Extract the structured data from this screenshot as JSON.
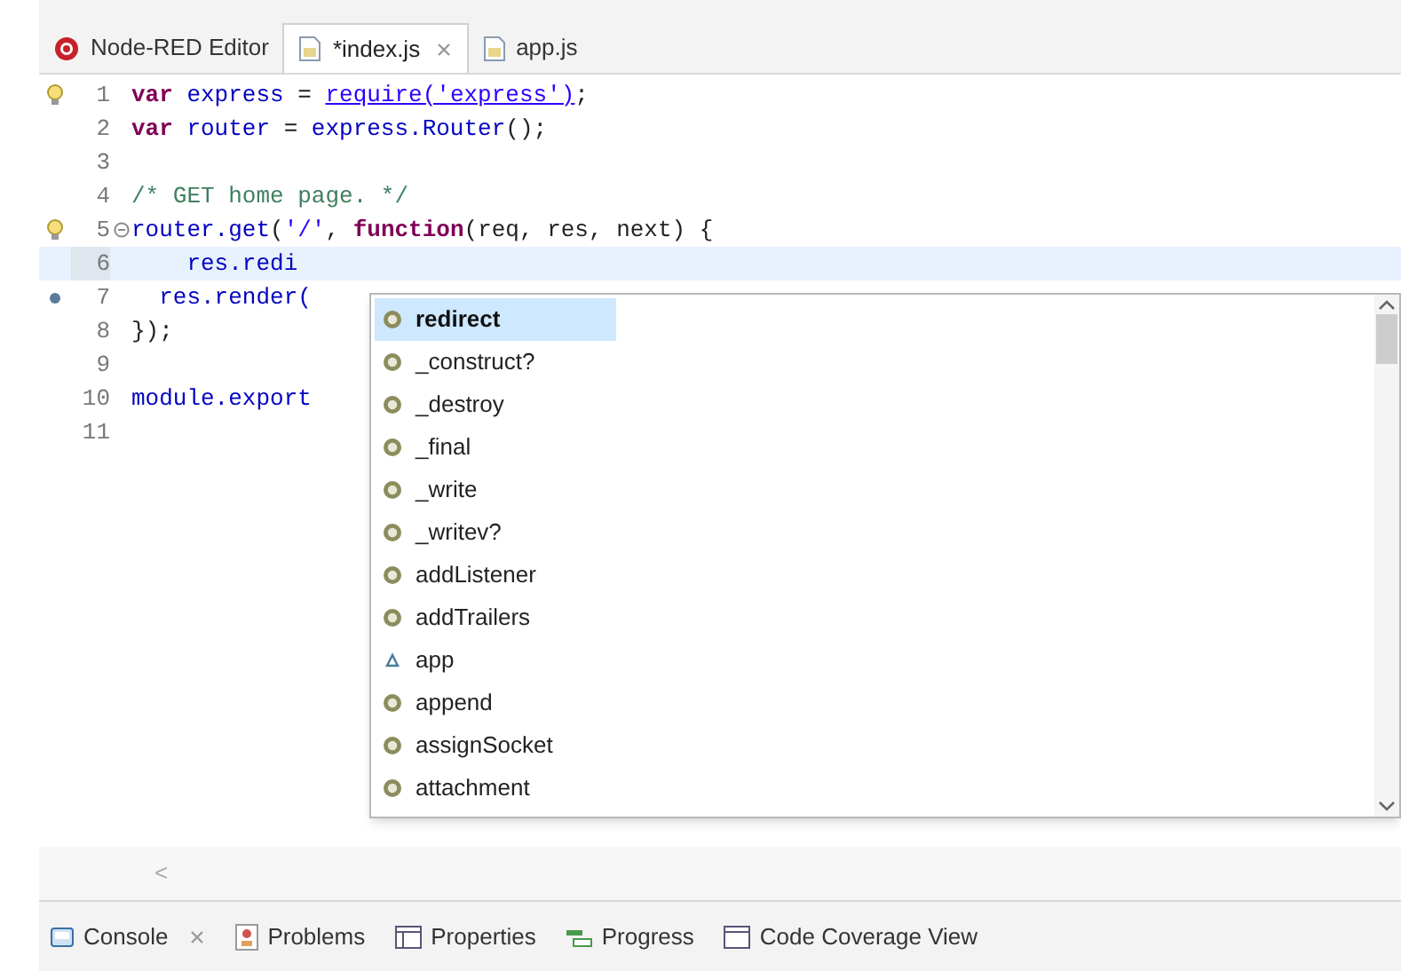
{
  "editor_tabs": [
    {
      "kind": "node-red",
      "label": "Node-RED Editor",
      "selected": false,
      "closable": false
    },
    {
      "kind": "file",
      "label": "*index.js",
      "selected": true,
      "closable": true
    },
    {
      "kind": "file",
      "label": "app.js",
      "selected": false,
      "closable": false
    }
  ],
  "code_lines": [
    {
      "number": "1",
      "kind": "lightbulb",
      "folded": false,
      "current": false,
      "segments": [
        {
          "kind": "keyword",
          "text": "var"
        },
        {
          "kind": "identifier",
          "text": " express"
        },
        {
          "kind": "plain",
          "text": " = "
        },
        {
          "kind": "link",
          "text": "require('express')"
        },
        {
          "kind": "plain",
          "text": ";"
        }
      ]
    },
    {
      "number": "2",
      "kind": "plain",
      "folded": false,
      "current": false,
      "segments": [
        {
          "kind": "keyword",
          "text": "var"
        },
        {
          "kind": "identifier",
          "text": " router"
        },
        {
          "kind": "plain",
          "text": " = "
        },
        {
          "kind": "identifier",
          "text": "express.Router"
        },
        {
          "kind": "plain",
          "text": "();"
        }
      ]
    },
    {
      "number": "3",
      "kind": "plain",
      "folded": false,
      "current": false
    },
    {
      "number": "4",
      "kind": "plain",
      "folded": false,
      "current": false,
      "segments": [
        {
          "kind": "comment",
          "text": "/* GET home page. */"
        }
      ]
    },
    {
      "number": "5",
      "kind": "lightbulb",
      "folded": true,
      "current": false,
      "segments": [
        {
          "kind": "identifier",
          "text": "router.get"
        },
        {
          "kind": "plain",
          "text": "("
        },
        {
          "kind": "string",
          "text": "'/'"
        },
        {
          "kind": "plain",
          "text": ", "
        },
        {
          "kind": "keyword",
          "text": "function"
        },
        {
          "kind": "plain",
          "text": "(req, res, next) {"
        }
      ]
    },
    {
      "number": "6",
      "kind": "plain",
      "folded": false,
      "current": true,
      "segments": [
        {
          "kind": "identifier",
          "text": "    res.redi"
        }
      ]
    },
    {
      "number": "7",
      "kind": "breakpoint",
      "folded": false,
      "current": false,
      "segments": [
        {
          "kind": "identifier",
          "text": "  res.render("
        }
      ]
    },
    {
      "number": "8",
      "kind": "plain",
      "folded": false,
      "current": false,
      "segments": [
        {
          "kind": "plain",
          "text": "});"
        }
      ]
    },
    {
      "number": "9",
      "kind": "plain",
      "folded": false,
      "current": false
    },
    {
      "number": "10",
      "kind": "plain",
      "folded": false,
      "current": false,
      "segments": [
        {
          "kind": "identifier",
          "text": "module.export"
        }
      ]
    },
    {
      "number": "11",
      "kind": "plain",
      "folded": false,
      "current": false
    }
  ],
  "completions": [
    {
      "kind": "method",
      "label": "redirect",
      "selected": true
    },
    {
      "kind": "method",
      "label": "_construct?",
      "selected": false
    },
    {
      "kind": "method",
      "label": "_destroy",
      "selected": false
    },
    {
      "kind": "method",
      "label": "_final",
      "selected": false
    },
    {
      "kind": "method",
      "label": "_write",
      "selected": false
    },
    {
      "kind": "method",
      "label": "_writev?",
      "selected": false
    },
    {
      "kind": "method",
      "label": "addListener",
      "selected": false
    },
    {
      "kind": "method",
      "label": "addTrailers",
      "selected": false
    },
    {
      "kind": "property",
      "label": "app",
      "selected": false
    },
    {
      "kind": "method",
      "label": "append",
      "selected": false
    },
    {
      "kind": "method",
      "label": "assignSocket",
      "selected": false
    },
    {
      "kind": "method",
      "label": "attachment",
      "selected": false
    }
  ],
  "scroll_left_arrow": "<",
  "bottom_tabs": [
    {
      "kind": "console",
      "label": "Console",
      "closable": true
    },
    {
      "kind": "problems",
      "label": "Problems",
      "closable": false
    },
    {
      "kind": "properties",
      "label": "Properties",
      "closable": false
    },
    {
      "kind": "progress",
      "label": "Progress",
      "closable": false
    },
    {
      "kind": "coverage",
      "label": "Code Coverage View",
      "closable": false
    }
  ]
}
